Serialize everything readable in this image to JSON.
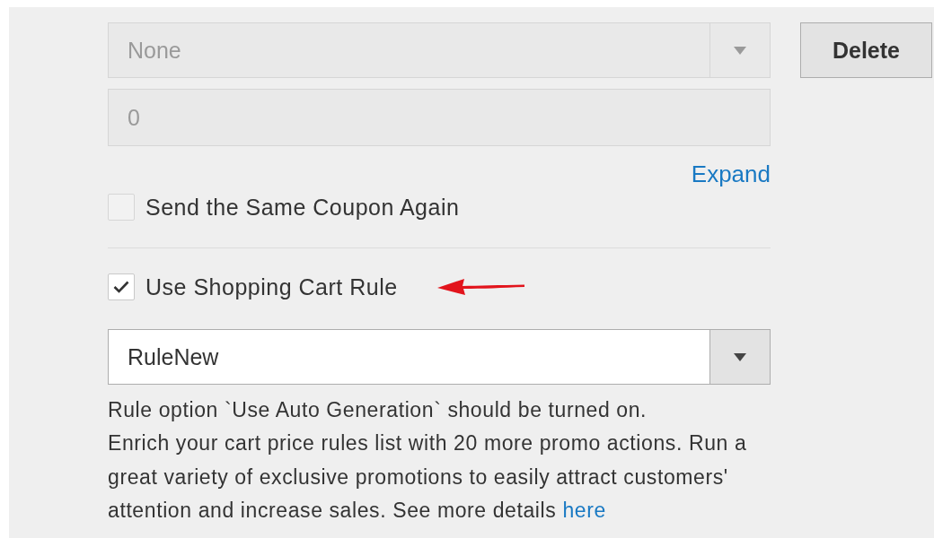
{
  "top_select": {
    "value": "None",
    "disabled": true
  },
  "delete_button": "Delete",
  "number_field": {
    "value": "0",
    "disabled": true
  },
  "expand_link": "Expand",
  "send_same_coupon": {
    "label": "Send the Same Coupon Again",
    "checked": false
  },
  "use_cart_rule": {
    "label": "Use Shopping Cart Rule",
    "checked": true
  },
  "cart_rule_select": {
    "value": "RuleNew",
    "disabled": false
  },
  "note": "Rule option `Use Auto Generation` should be turned on.",
  "promo_text": "Enrich your cart price rules list with 20 more promo actions. Run a great variety of exclusive promotions to easily attract customers' attention and increase sales. See more details",
  "promo_link": "here"
}
